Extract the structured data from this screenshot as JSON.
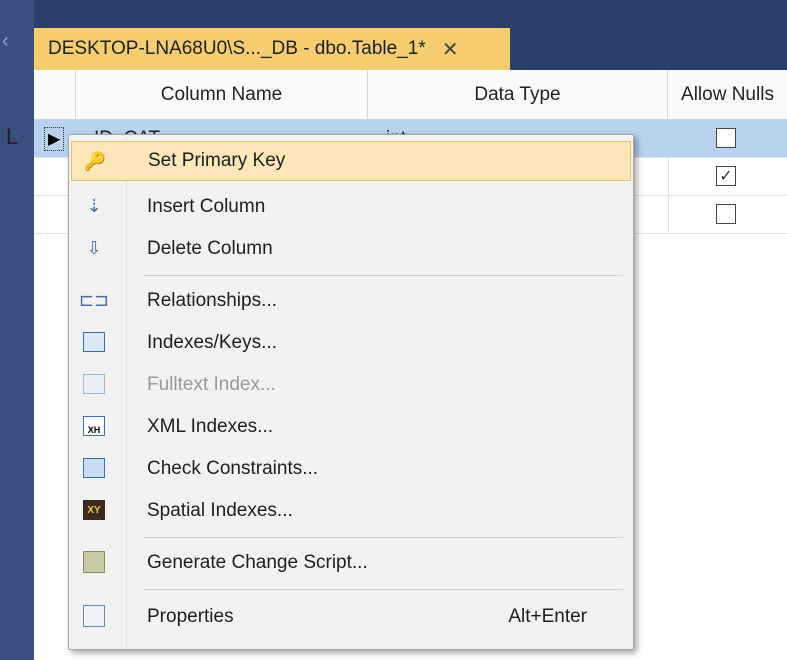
{
  "tab": {
    "title": "DESKTOP-LNA68U0\\S..._DB - dbo.Table_1*",
    "close_glyph": "✕"
  },
  "grid": {
    "headers": [
      "Column Name",
      "Data Type",
      "Allow Nulls"
    ],
    "rows": [
      {
        "name": "ID_CAT",
        "type": "int",
        "allow_nulls": false,
        "selected": true
      },
      {
        "name": "",
        "type": "",
        "allow_nulls": true,
        "selected": false
      },
      {
        "name": "",
        "type": "",
        "allow_nulls": false,
        "selected": false
      }
    ],
    "gutter_letter": "L",
    "row_arrow": "▶"
  },
  "context_menu": {
    "items": [
      {
        "label": "Set Primary Key",
        "icon": "key-icon",
        "highlighted": true,
        "enabled": true
      },
      {
        "label": "Insert Column",
        "icon": "insert-column-icon",
        "enabled": true
      },
      {
        "label": "Delete Column",
        "icon": "delete-column-icon",
        "enabled": true
      },
      {
        "label": "Relationships...",
        "icon": "relationships-icon",
        "enabled": true
      },
      {
        "label": "Indexes/Keys...",
        "icon": "indexes-keys-icon",
        "enabled": true
      },
      {
        "label": "Fulltext Index...",
        "icon": "fulltext-index-icon",
        "enabled": false
      },
      {
        "label": "XML Indexes...",
        "icon": "xml-indexes-icon",
        "enabled": true
      },
      {
        "label": "Check Constraints...",
        "icon": "check-constraints-icon",
        "enabled": true
      },
      {
        "label": "Spatial Indexes...",
        "icon": "spatial-indexes-icon",
        "enabled": true
      },
      {
        "label": "Generate Change Script...",
        "icon": "generate-script-icon",
        "enabled": true
      },
      {
        "label": "Properties",
        "icon": "properties-icon",
        "enabled": true,
        "shortcut": "Alt+Enter"
      }
    ]
  },
  "colors": {
    "tab_active": "#f5cc6e",
    "row_selected": "#b9d2ef",
    "menu_highlight": "#fde7b8",
    "ide_chrome": "#2b3f6b"
  }
}
